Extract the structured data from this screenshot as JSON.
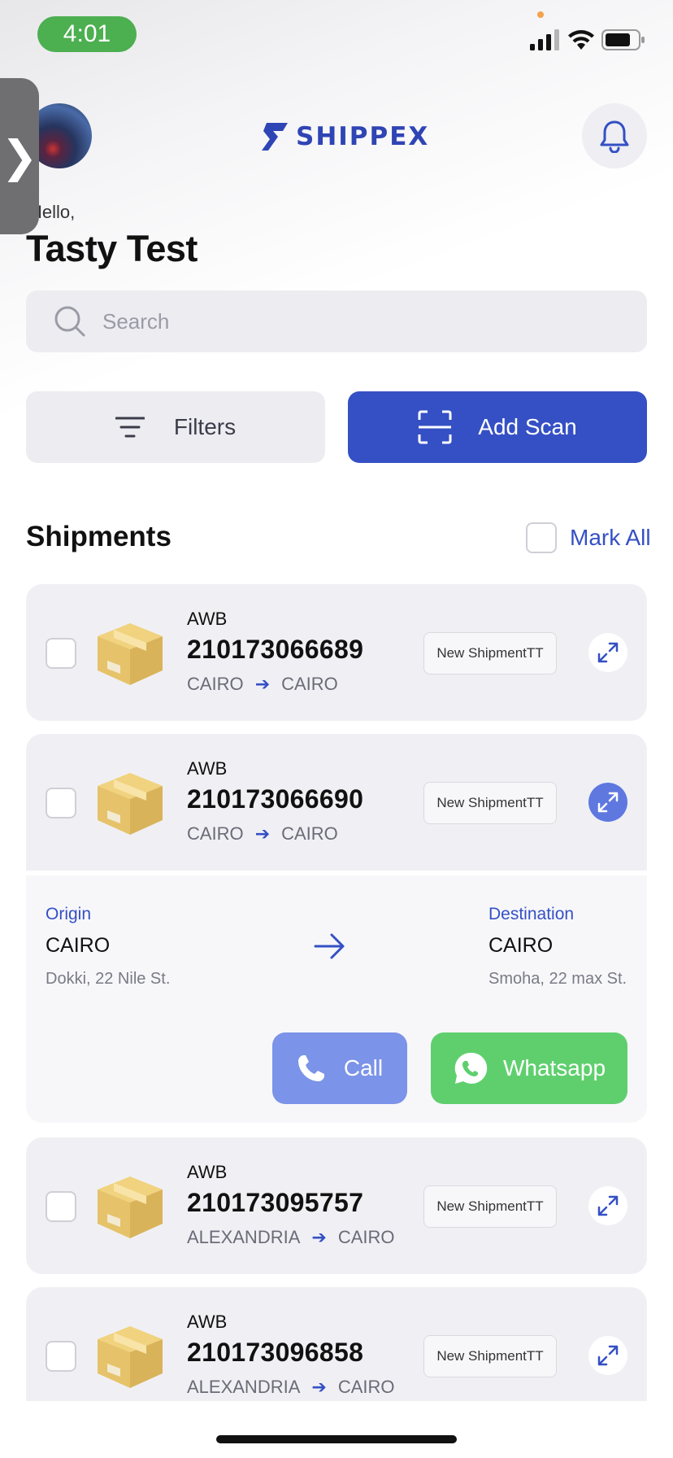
{
  "status_bar": {
    "time": "4:01"
  },
  "header": {
    "brand": "SHIPPEX",
    "greeting": "Hello,",
    "user_name": "Tasty Test"
  },
  "search": {
    "placeholder": "Search"
  },
  "actions": {
    "filters_label": "Filters",
    "scan_label": "Add Scan"
  },
  "shipments": {
    "title": "Shipments",
    "mark_all_label": "Mark All",
    "items": [
      {
        "awb_label": "AWB",
        "awb": "210173066689",
        "from": "CAIRO",
        "to": "CAIRO",
        "status": "New ShipmentTT"
      },
      {
        "awb_label": "AWB",
        "awb": "210173066690",
        "from": "CAIRO",
        "to": "CAIRO",
        "status": "New ShipmentTT"
      },
      {
        "awb_label": "AWB",
        "awb": "210173095757",
        "from": "ALEXANDRIA",
        "to": "CAIRO",
        "status": "New ShipmentTT"
      },
      {
        "awb_label": "AWB",
        "awb": "210173096858",
        "from": "ALEXANDRIA",
        "to": "CAIRO",
        "status": "New ShipmentTT"
      }
    ],
    "expanded": {
      "origin_label": "Origin",
      "origin_city": "CAIRO",
      "origin_address": "Dokki, 22 Nile St.",
      "destination_label": "Destination",
      "destination_city": "CAIRO",
      "destination_address": "Smoha, 22 max St.",
      "call_label": "Call",
      "whatsapp_label": "Whatsapp"
    }
  },
  "colors": {
    "primary": "#3550c4",
    "call": "#7b93e8",
    "whatsapp": "#5fcf6e",
    "card": "#f0f0f4",
    "box": "#e6c36a"
  }
}
